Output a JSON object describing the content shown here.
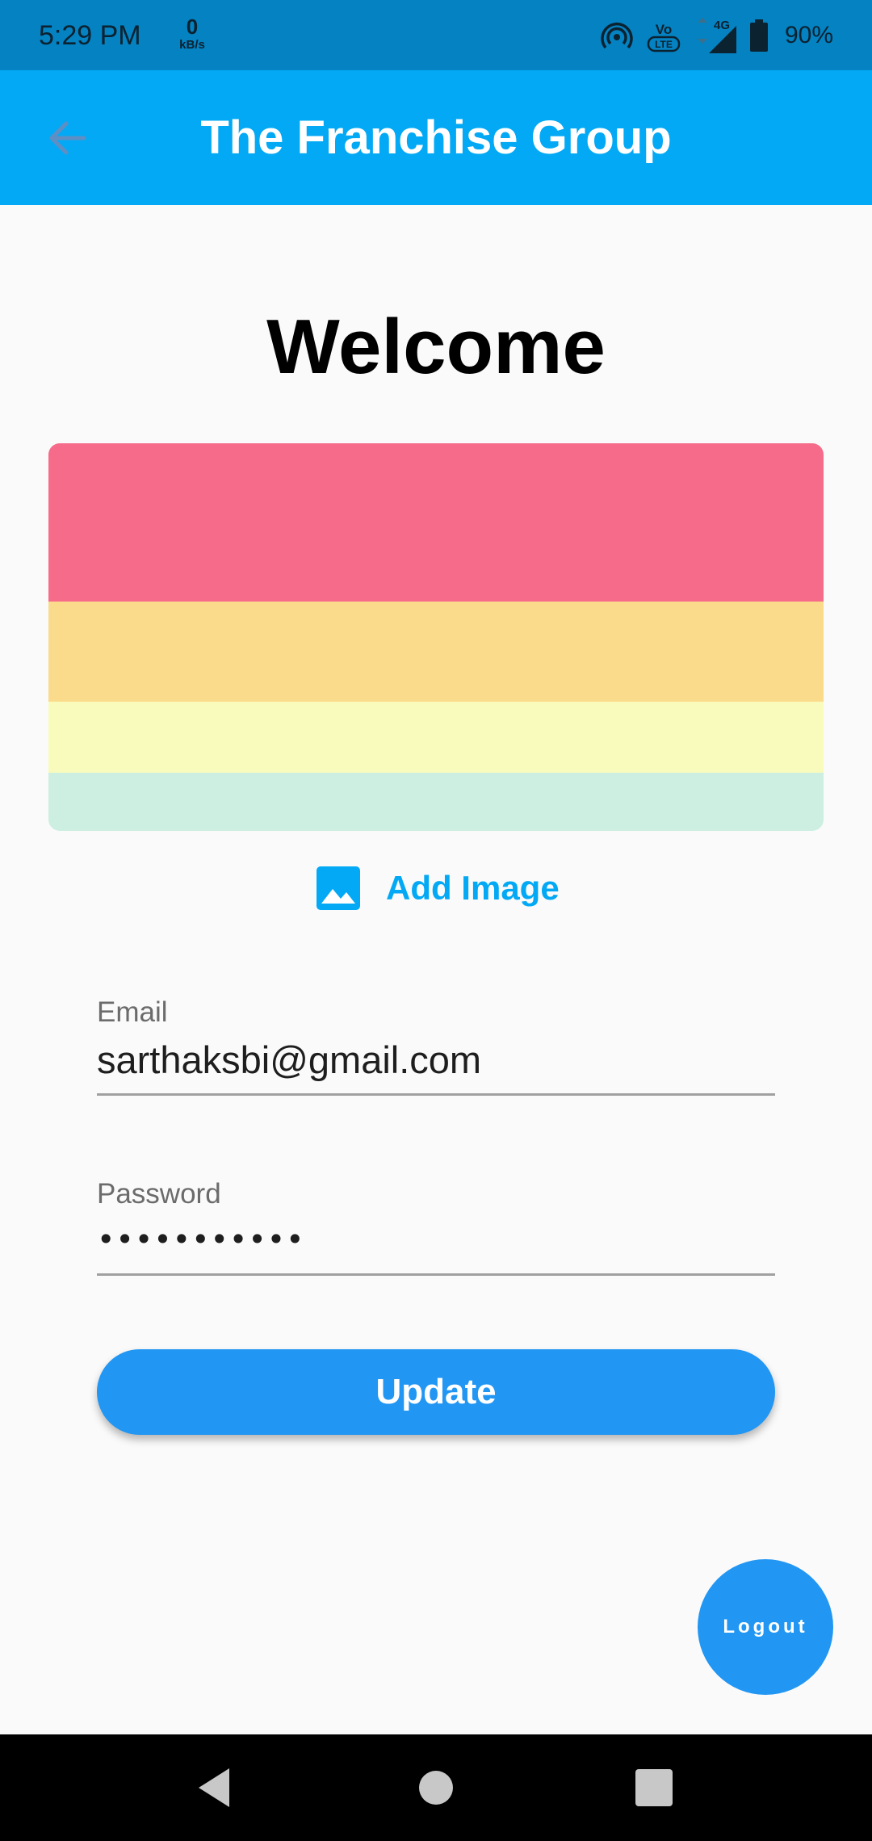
{
  "status_bar": {
    "time": "5:29 PM",
    "net_speed_value": "0",
    "net_speed_unit": "kB/s",
    "icons": [
      "hotspot-icon",
      "volte-icon",
      "network-4g-icon",
      "signal-icon",
      "battery-icon"
    ],
    "network_label": "4G",
    "volte_label": "Vo LTE",
    "battery_percent": "90%"
  },
  "app_bar": {
    "title": "The Franchise Group",
    "back_icon": "arrow-back-icon"
  },
  "main": {
    "heading": "Welcome",
    "banner_colors": [
      "#f76b8a",
      "#f9db8b",
      "#f8fbbb",
      "#cdefe2"
    ],
    "add_image": {
      "icon": "image-icon",
      "label": "Add Image"
    },
    "email": {
      "label": "Email",
      "value": "sarthaksbi@gmail.com"
    },
    "password": {
      "label": "Password",
      "value": "•••••••••••"
    },
    "update_label": "Update"
  },
  "fab": {
    "logout_label": "Logout"
  },
  "nav_bar": {
    "buttons": [
      "back-triangle-icon",
      "home-circle-icon",
      "recents-square-icon"
    ]
  },
  "colors": {
    "status_bar": "#0482c2",
    "app_bar": "#03a9f4",
    "primary_button": "#2196f3",
    "accent_text": "#03a9f4",
    "background": "#fafafa"
  }
}
